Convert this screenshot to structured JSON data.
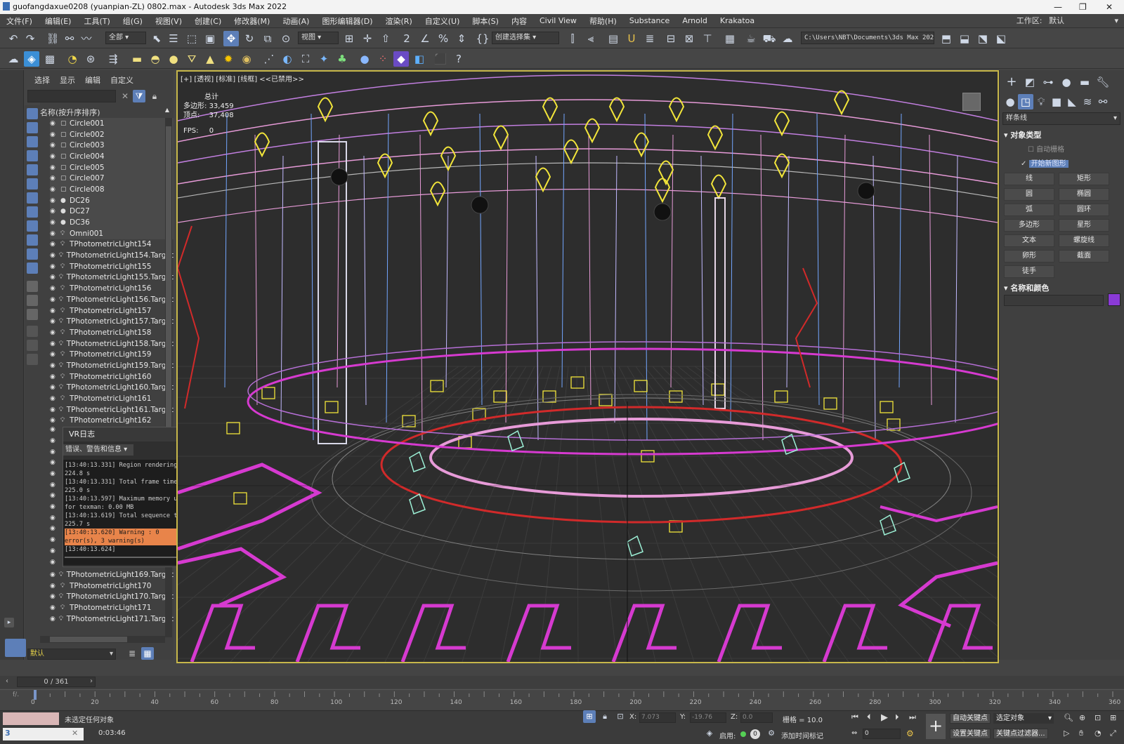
{
  "titlebar": {
    "title": "guofangdaxue0208  (yuanpian-ZL)  0802.max - Autodesk 3ds Max 2022"
  },
  "menu": [
    "文件(F)",
    "编辑(E)",
    "工具(T)",
    "组(G)",
    "视图(V)",
    "创建(C)",
    "修改器(M)",
    "动画(A)",
    "图形编辑器(D)",
    "渲染(R)",
    "自定义(U)",
    "脚本(S)",
    "内容",
    "Civil View",
    "帮助(H)",
    "Substance",
    "Arnold",
    "Krakatoa"
  ],
  "workspace": {
    "label": "工作区:",
    "value": "默认"
  },
  "toolbar1": {
    "select_filter": "全部",
    "ref_coord": "视图",
    "named_selection": "创建选择集",
    "project_path": "C:\\Users\\NBT\\Documents\\3ds Max 2022"
  },
  "scene_explorer": {
    "tabs": [
      "选择",
      "显示",
      "编辑",
      "自定义"
    ],
    "column_header": "名称(按升序排序)",
    "items_top": [
      "Circle001",
      "Circle002",
      "Circle003",
      "Circle004",
      "Circle005",
      "Circle007",
      "Circle008",
      "DC26",
      "DC27",
      "DC36",
      "Omni001",
      "TPhotometricLight154",
      "TPhotometricLight154.Target",
      "TPhotometricLight155",
      "TPhotometricLight155.Target",
      "TPhotometricLight156",
      "TPhotometricLight156.Target",
      "TPhotometricLight157",
      "TPhotometricLight157.Target",
      "TPhotometricLight158",
      "TPhotometricLight158.Target",
      "TPhotometricLight159",
      "TPhotometricLight159.Target",
      "TPhotometricLight160",
      "TPhotometricLight160.Target",
      "TPhotometricLight161",
      "TPhotometricLight161.Target",
      "TPhotometricLight162"
    ],
    "items_bottom": [
      "TPhotometricLight169.Target",
      "TPhotometricLight170",
      "TPhotometricLight170.Target",
      "TPhotometricLight171",
      "TPhotometricLight171.Target"
    ],
    "layer": "默认"
  },
  "vray_log": {
    "title": "VR日志",
    "filter": "错误、警告和信息",
    "lines": [
      "[13:40:13.331] Region rendering: 224.8 s",
      "[13:40:13.331] Total frame time: 225.0 s",
      "[13:40:13.597] Maximum memory usage for texman: 0.00 MB",
      "[13:40:13.619] Total sequence time: 225.7 s"
    ],
    "warning": "[13:40:13.620] Warning : 0 error(s), 3 warning(s)",
    "last": "[13:40:13.624]"
  },
  "viewport": {
    "label": "[+] [透视] [标准] [线框] <<已禁用>>",
    "stats_total": "总计",
    "polys_label": "多边形:",
    "polys": "33,459",
    "verts_label": "顶点:",
    "verts": "37,408",
    "fps_label": "FPS:",
    "fps": "0"
  },
  "command_panel": {
    "category": "样条线",
    "object_type_title": "对象类型",
    "auto_grid": "自动栅格",
    "start_new_shape": "开始新图形",
    "buttons": [
      "线",
      "矩形",
      "圆",
      "椭圆",
      "弧",
      "圆环",
      "多边形",
      "星形",
      "文本",
      "螺旋线",
      "卵形",
      "截面",
      "徒手"
    ],
    "name_color_title": "名称和颜色",
    "object_color": "#8a3ad6"
  },
  "timeline": {
    "frame": "0 / 361",
    "ticks": [
      "0",
      "20",
      "40",
      "60",
      "80",
      "100",
      "120",
      "140",
      "160",
      "180",
      "200",
      "220",
      "240",
      "260",
      "280",
      "300",
      "320",
      "340",
      "360"
    ]
  },
  "statusbar": {
    "selection": "未选定任何对象",
    "time": "0:03:46",
    "x_label": "X:",
    "x_value": "7.073",
    "y_label": "Y:",
    "y_value": "-19.76",
    "z_label": "Z:",
    "z_value": "0.0",
    "grid": "栅格 = 10.0",
    "enable": "启用:",
    "add_time_tag": "添加时间标记",
    "auto_key": "自动关键点",
    "set_key": "设置关键点",
    "selected_obj": "选定对象",
    "key_filters": "关键点过滤器...",
    "frame_field": "0"
  },
  "colors": {
    "viewport_border": "#c7b74a",
    "magenta": "#d63ad0",
    "red": "#d12a2a",
    "pink": "#e79bd8",
    "yellow": "#f2e53a",
    "cyan": "#9cf0d6",
    "blue_line": "#73a6ff"
  }
}
